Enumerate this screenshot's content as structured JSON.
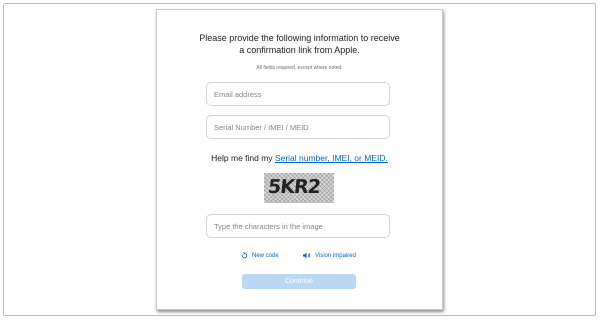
{
  "dialog": {
    "title_line1": "Please provide the following information to receive",
    "title_line2": "a confirmation link from Apple.",
    "required_note": "All fields required, except where noted."
  },
  "fields": {
    "email_placeholder": "Email address",
    "serial_placeholder": "Serial Number / IMEI / MEID",
    "captcha_placeholder": "Type the characters in the image"
  },
  "help": {
    "prefix": "Help me find my",
    "link": "Serial number, IMEI, or MEID."
  },
  "captcha": {
    "text": "5KR2"
  },
  "captcha_actions": {
    "new_code": "New code",
    "vision_impaired": "Vision impaired"
  },
  "continue_label": "Continue",
  "colors": {
    "link": "#0066cc",
    "button_disabled": "#b9d8f6"
  }
}
